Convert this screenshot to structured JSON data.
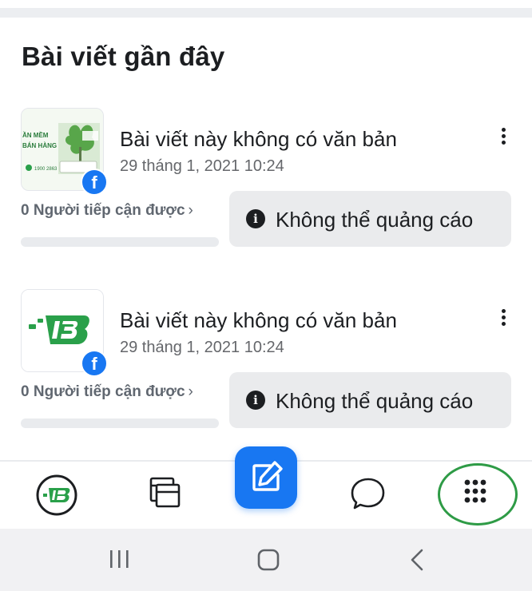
{
  "section": {
    "title": "Bài viết gần đây"
  },
  "posts": [
    {
      "title": "Bài viết này không có văn bản",
      "date": "29 tháng 1, 2021 10:24",
      "reach": "0 Người tiếp cận được",
      "boost_label": "Không thể quảng cáo",
      "thumb_text": [
        "ẦN MỀM",
        "BÁN HÀNG",
        "1900 2863"
      ]
    },
    {
      "title": "Bài viết này không có văn bản",
      "date": "29 tháng 1, 2021 10:24",
      "reach": "0 Người tiếp cận được",
      "boost_label": "Không thể quảng cáo"
    }
  ],
  "badges": {
    "facebook": "f"
  },
  "colors": {
    "brand": "#1877f2",
    "highlight_ring": "#2e9b46",
    "logo_green": "#2aa04a"
  },
  "icons": {
    "profile": "page-logo-icon",
    "compose": "compose-icon",
    "posts": "posts-icon",
    "messages": "chat-bubble-icon",
    "menu": "grid-menu-icon",
    "nav_recent": "recent-apps-icon",
    "nav_home": "home-icon",
    "nav_back": "back-icon"
  }
}
